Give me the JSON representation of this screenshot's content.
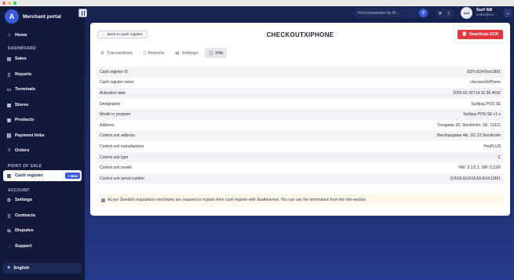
{
  "window": {
    "title": "Merchant portal"
  },
  "brand": {
    "logo_letter": "A",
    "name": "Merchant portal"
  },
  "sidebar": {
    "home": "Home",
    "section_dashboard": "DASHBOARD",
    "sales": "Sales",
    "reports": "Reports",
    "terminals": "Terminals",
    "stores": "Stores",
    "products": "Products",
    "payment_links": "Payment links",
    "orders": "Orders",
    "section_pos": "POINT OF SALE",
    "cash_register": "Cash register",
    "new_badge": "+ New",
    "section_account": "ACCOUNT",
    "settings": "Settings",
    "contracts": "Contracts",
    "disputes": "Disputes",
    "support": "Support",
    "language": "English"
  },
  "topbar": {
    "search_placeholder": "Find transaction by ID...",
    "user_name": "Surf AB",
    "user_email": "surfer@sur...",
    "avatar_text": "surf"
  },
  "page": {
    "back_label": "Back to cash register",
    "title": "CHECKOUTXIPHONE",
    "deactivate_label": "Deactivate ECR",
    "tabs": [
      "Transactions",
      "Reports",
      "Settings",
      "Info"
    ],
    "active_tab": "Info",
    "info": [
      {
        "label": "Cash register ID",
        "value": "82f7c6247bcb1891"
      },
      {
        "label": "Cash register name",
        "value": "checkoutXiPhone"
      },
      {
        "label": "Activation date",
        "value": "2025-02-26T14:31:36.450Z"
      },
      {
        "label": "Designation",
        "value": "Surfpay POS SE"
      },
      {
        "label": "Model or program",
        "value": "Surfpay POS SE v1.x"
      },
      {
        "label": "Address",
        "value": "Torsgatan 30, Stockholm, SE, 11321"
      },
      {
        "label": "Control unit address",
        "value": "Barnhusgatan 4A, 111 23 Stockholm"
      },
      {
        "label": "Control unit manufacturer",
        "value": "PosPLUS"
      },
      {
        "label": "Control unit type",
        "value": "C"
      },
      {
        "label": "Control unit model",
        "value": "HW: 3.1/2.1, SW: 0.23/0"
      },
      {
        "label": "Control unit serial number",
        "value": "DJUUUUUUUUUUUUU1891"
      }
    ],
    "note": "As per Swedish regulations merchants are required to register their cash register with Skatteverket. You can use the information from the info-section."
  },
  "colors": {
    "accent": "#3a5bd9",
    "danger": "#e2383f",
    "sidebar_bg": "#111a3d"
  }
}
